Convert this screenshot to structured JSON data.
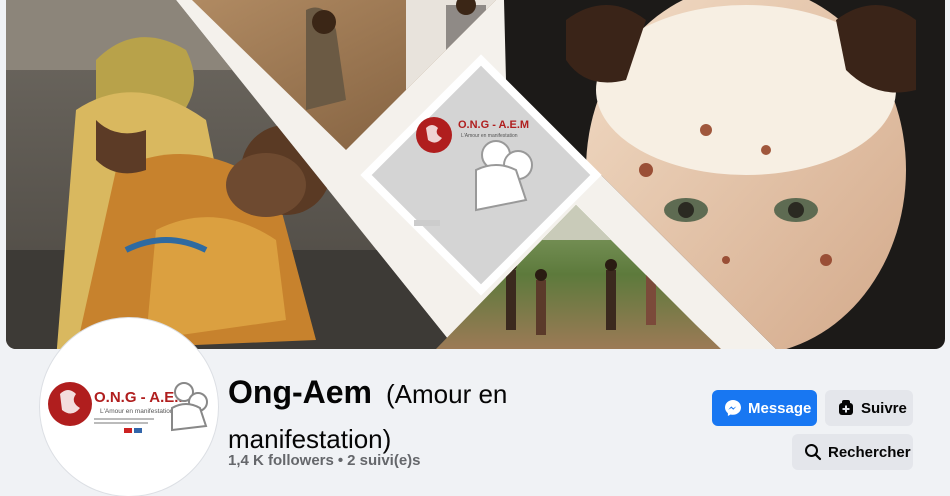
{
  "cover": {
    "logo_title": "O.N.G - A.E.M",
    "logo_subtitle": "L'Amour en manifestation",
    "icon": "collage-cover-photo"
  },
  "avatar": {
    "logo_title": "O.N.G - A.E.M",
    "logo_subtitle": "L'Amour en manifestation",
    "icon": "organization-logo"
  },
  "page": {
    "name": "Ong-Aem",
    "subtitle_line1": "(Amour en",
    "subtitle_line2": "manifestation)",
    "followers": "1,4 K followers",
    "separator": "•",
    "following": "2 suivi(e)s"
  },
  "actions": {
    "message_label": "Message",
    "message_icon": "messenger-icon",
    "follow_label": "Suivre",
    "follow_icon": "follow-plus-icon",
    "search_label": "Rechercher",
    "search_icon": "search-icon"
  },
  "colors": {
    "accent": "#1877f2",
    "secondary_button": "#e4e6eb",
    "logo_red": "#b01e1e"
  }
}
